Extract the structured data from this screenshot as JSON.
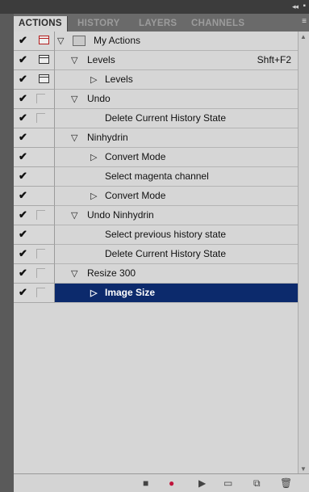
{
  "window": {
    "collapse_icon": "double-chevron-left",
    "menu_icon": "panel-menu"
  },
  "tabs": [
    {
      "label": "ACTIONS"
    },
    {
      "label": "HISTORY"
    },
    {
      "label": "LAYERS"
    },
    {
      "label": "CHANNELS"
    }
  ],
  "set": {
    "name": "My Actions"
  },
  "rows": [
    {
      "label": "Levels",
      "shortcut": "Shft+F2"
    },
    {
      "label": "Levels"
    },
    {
      "label": "Undo"
    },
    {
      "label": "Delete Current History State"
    },
    {
      "label": "Ninhydrin"
    },
    {
      "label": "Convert Mode"
    },
    {
      "label": "Select magenta channel"
    },
    {
      "label": "Convert Mode"
    },
    {
      "label": "Undo Ninhydrin"
    },
    {
      "label": "Select previous history state"
    },
    {
      "label": "Delete Current History State"
    },
    {
      "label": "Resize 300"
    },
    {
      "label": "Image Size"
    }
  ],
  "colors": {
    "selection": "#0c2a6c",
    "record": "#c0143c"
  }
}
